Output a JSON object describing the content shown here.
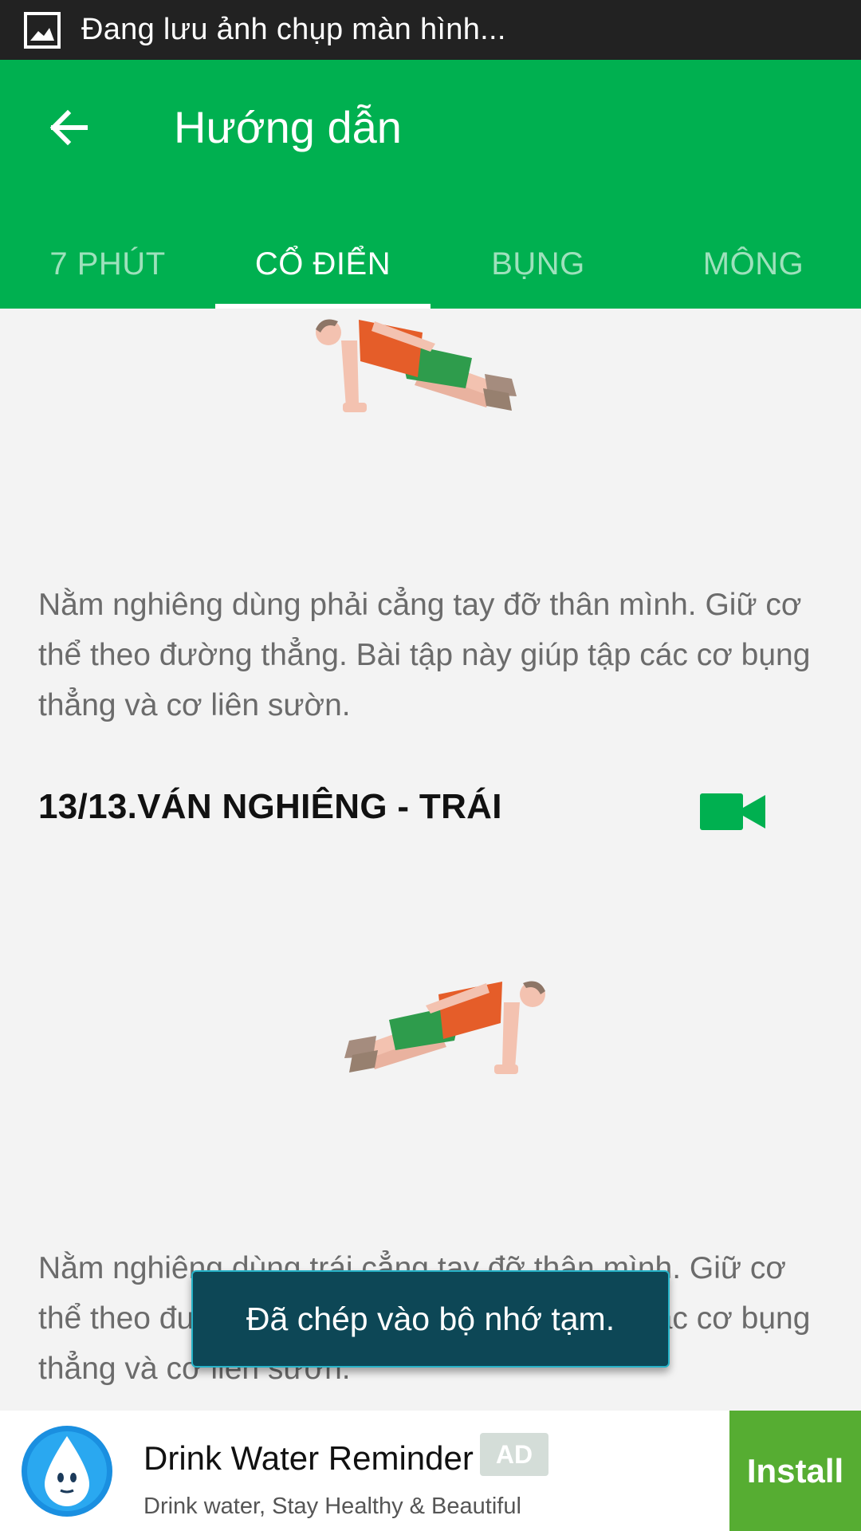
{
  "statusbar": {
    "text": "Đang lưu ảnh chụp màn hình..."
  },
  "appbar": {
    "title": "Hướng dẫn"
  },
  "tabs": [
    {
      "label": "7 PHÚT",
      "active": false
    },
    {
      "label": "CỔ ĐIỂN",
      "active": true
    },
    {
      "label": "BỤNG",
      "active": false
    },
    {
      "label": "MÔNG",
      "active": false
    }
  ],
  "exercises": [
    {
      "description": "Nằm nghiêng dùng phải cẳng tay đỡ thân mình. Giữ cơ thể theo đường thẳng. Bài tập này giúp tập các cơ bụng thẳng và cơ liên sườn."
    },
    {
      "title": "13/13.VÁN NGHIÊNG - TRÁI",
      "description": "Nằm nghiêng dùng trái cẳng tay đỡ thân mình. Giữ cơ thể theo đường thẳng. Bài tập này giúp tập các cơ bụng thẳng và cơ liên sườn."
    }
  ],
  "toast": {
    "text": "Đã chép vào bộ nhớ tạm."
  },
  "ad": {
    "title": "Drink Water Reminder",
    "badge": "AD",
    "subtitle": "Drink water, Stay Healthy & Beautiful",
    "install_label": "Install"
  },
  "colors": {
    "primary": "#00b050",
    "install": "#56ad32",
    "toast": "#0d4756"
  },
  "icons": {
    "back": "arrow-left-icon",
    "video": "video-camera-icon"
  }
}
